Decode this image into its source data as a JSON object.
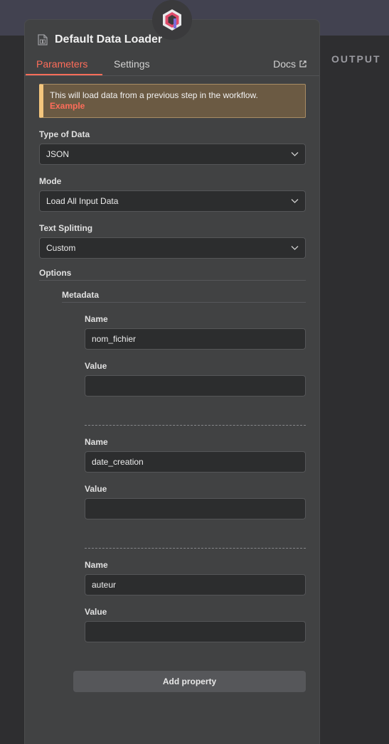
{
  "header": {
    "title": "Default Data Loader",
    "output_label": "OUTPUT"
  },
  "tabs": [
    {
      "label": "Parameters",
      "active": true
    },
    {
      "label": "Settings",
      "active": false
    }
  ],
  "docs": {
    "label": "Docs"
  },
  "notice": {
    "text": "This will load data from a previous step in the workflow.",
    "link": "Example"
  },
  "fields": {
    "type_of_data": {
      "label": "Type of Data",
      "value": "JSON"
    },
    "mode": {
      "label": "Mode",
      "value": "Load All Input Data"
    },
    "text_splitting": {
      "label": "Text Splitting",
      "value": "Custom"
    }
  },
  "options": {
    "label": "Options",
    "metadata_label": "Metadata",
    "properties": [
      {
        "name_label": "Name",
        "name_value": "nom_fichier",
        "value_label": "Value",
        "value": ""
      },
      {
        "name_label": "Name",
        "name_value": "date_creation",
        "value_label": "Value",
        "value": ""
      },
      {
        "name_label": "Name",
        "name_value": "auteur",
        "value_label": "Value",
        "value": ""
      }
    ],
    "add_property_label": "Add property"
  },
  "colors": {
    "accent": "#ff6d5a",
    "panel_bg": "#414243",
    "input_bg": "#2c2d2e",
    "notice_bg": "#6b5a43",
    "notice_border": "#f4c67d"
  },
  "icons": {
    "node": "n8n-node-icon",
    "title": "document-icon",
    "docs": "external-link-icon",
    "select": "chevron-down-icon"
  }
}
